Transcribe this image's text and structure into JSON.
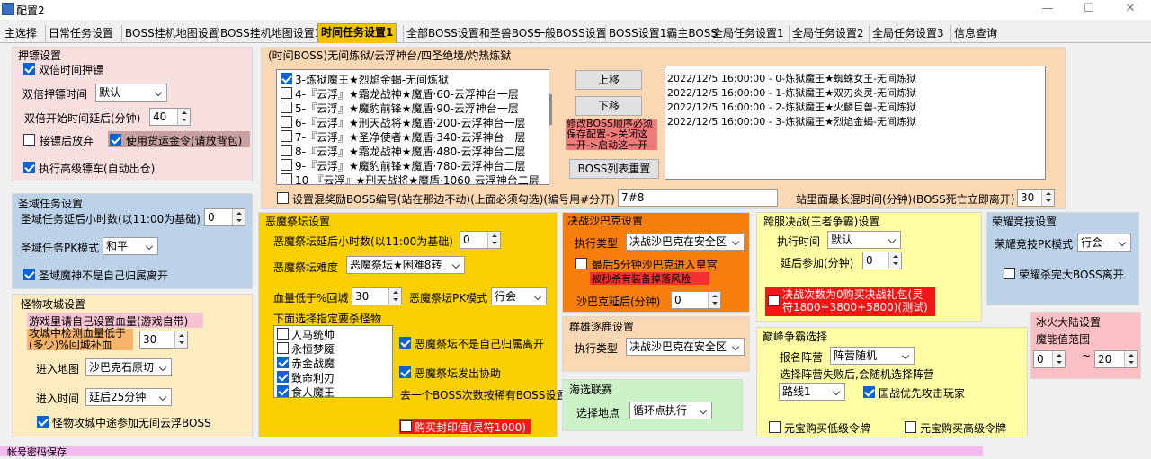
{
  "window": {
    "title": "配置2",
    "minimize": "—",
    "maximize": "☐",
    "close": "✕"
  },
  "tabs": [
    "主选择",
    "日常任务设置",
    "BOSS挂机地图设置",
    "BOSS挂机地图设置1",
    "时间任务设置1",
    "全部BOSS设置和圣兽BOSS",
    "一般BOSS设置",
    "BOSS设置1霸主BOSS",
    "全局任务设置1",
    "全局任务设置2",
    "全局任务设置3",
    "信息查询"
  ],
  "yabiao": {
    "title": "押镖设置",
    "double_time": "双倍时间押镖",
    "double_time_label": "双倍押镖时间",
    "double_time_value": "默认",
    "delay_label": "双倍开始时间延后(分钟)",
    "delay_value": "40",
    "give_up": "接镖后放弃",
    "use_goods": "使用货运金令(请放背包)",
    "auto_escort": "执行高级镖车(自动出仓)"
  },
  "shengyu": {
    "title": "圣域任务设置",
    "delay_label": "圣域任务延后小时数(以11:00为基础)",
    "delay_value": "0",
    "pk_label": "圣域任务PK模式",
    "pk_value": "和平",
    "leave": "圣域魔神不是自己归属离开"
  },
  "monster": {
    "title": "怪物攻城设置",
    "hint1": "游戏里请自己设置血量(游戏自带)",
    "hint2": "攻城中检测血量低于(多少)%回城补血",
    "hp_value": "30",
    "map_label": "进入地图",
    "map_value": "沙巴克石原切",
    "time_label": "进入时间",
    "time_value": "延后25分钟",
    "join": "怪物攻城中途参加无间云浮BOSS"
  },
  "time_boss": {
    "title": "(时间BOSS)无间炼狱/云浮神台/四圣绝境/灼热炼狱",
    "items": [
      {
        "text": "3-炼狱魔王★烈焰金蝎-无间炼狱",
        "checked": true
      },
      {
        "text": "4-『云浮』★霜龙战神★魔盾·60-云浮神台一层",
        "checked": false
      },
      {
        "text": "5-『云浮』★魔豹前锋★魔盾·90-云浮神台一层",
        "checked": false
      },
      {
        "text": "6-『云浮』★刑天战将★魔盾·200-云浮神台一层",
        "checked": false
      },
      {
        "text": "7-『云浮』★圣净使者★魔盾·340-云浮神台一层",
        "checked": false
      },
      {
        "text": "8-『云浮』★霜龙战神★魔盾·480-云浮神台二层",
        "checked": false
      },
      {
        "text": "9-『云浮』★魔豹前锋★魔盾·780-云浮神台二层",
        "checked": false
      },
      {
        "text": "10-『云浮』★刑天战将★魔盾·1060-云浮神台二层",
        "checked": false
      }
    ],
    "up": "上移",
    "down": "下移",
    "warn": "修改BOSS顺序必须保存配置->关闭这一开->启动这一开",
    "reset": "BOSS列表重置",
    "log": [
      "2022/12/5 16:00:00 - 0-炼狱魔王★蜘蛛女王-无间炼狱",
      "2022/12/5 16:00:00 - 1-炼狱魔王★双刃炎灵-无间炼狱",
      "2022/12/5 16:00:00 - 2-炼狱魔王★火麟巨兽-无间炼狱",
      "2022/12/5 16:00:00 - 3-炼狱魔王★烈焰金蝎-无间炼狱"
    ],
    "mixed_label": "设置混奖励BOSS编号(站在那边不动)(上面必须勾选)(编号用#分开)",
    "mixed_value": "7#8",
    "stand_label": "站里面最长混时间(分钟)(BOSS死亡立即离开)",
    "stand_value": "30"
  },
  "demon": {
    "title": "恶魔祭坛设置",
    "delay_label": "恶魔祭坛延后小时数(以11:00为基础)",
    "delay_value": "0",
    "diff_label": "恶魔祭坛难度",
    "diff_value": "恶魔祭坛★困难8转",
    "hp_label": "血量低于%回城",
    "hp_value": "30",
    "pk_label": "恶魔祭坛PK模式",
    "pk_value": "行会",
    "kill_label": "下面选择指定要杀怪物",
    "monsters": [
      {
        "text": "人马统帅",
        "checked": false
      },
      {
        "text": "永恒梦魇",
        "checked": false
      },
      {
        "text": "赤金战魔",
        "checked": true
      },
      {
        "text": "致命利刃",
        "checked": true
      },
      {
        "text": "食人魔王",
        "checked": true
      }
    ],
    "not_own": "恶魔祭坛不是自己归属离开",
    "assist": "恶魔祭坛发出协助",
    "note": "去一个BOSS次数按稀有BOSS设置",
    "buy": "购买封印值(灵符1000)"
  },
  "shabake": {
    "title": "决战沙巴克设置",
    "type_label": "执行类型",
    "type_value": "决战沙巴克在安全区",
    "last5": "最后5分钟沙巴克进入皇宫",
    "warn": "被秒杀有装备掉落风险",
    "delay_label": "沙巴克延后(分钟)",
    "delay_value": "0"
  },
  "qunxiong": {
    "title": "群雄逐鹿设置",
    "type_label": "执行类型",
    "type_value": "决战沙巴克在安全区"
  },
  "haixuan": {
    "title": "海选联赛",
    "loc_label": "选择地点",
    "loc_value": "循环点执行"
  },
  "kuafu": {
    "title": "跨服决战(王者争霸)设置",
    "time_label": "执行时间",
    "time_value": "默认",
    "delay_label": "延后参加(分钟)",
    "delay_value": "0",
    "buy": "决战次数为0购买决战礼包(灵符1800+3800+5800)(测试)"
  },
  "dianfeng": {
    "title": "巅峰争霸选择",
    "camp_label": "报名阵营",
    "camp_value": "阵营随机",
    "hint": "选择阵营失败后,会随机选择阵营",
    "road_value": "路线1",
    "prefer": "国战优先攻击玩家",
    "low": "元宝购买低级令牌",
    "high": "元宝购买高级令牌"
  },
  "rongyao": {
    "title": "荣耀竞技设置",
    "pk_label": "荣耀竞技PK模式",
    "pk_value": "行会",
    "leave": "荣耀杀完大BOSS离开"
  },
  "binghuo": {
    "title": "冰火大陆设置",
    "range_label": "魔能值范围",
    "min": "0",
    "tilde": "~",
    "max": "20"
  },
  "footer": {
    "title": "帐号密码保存"
  }
}
